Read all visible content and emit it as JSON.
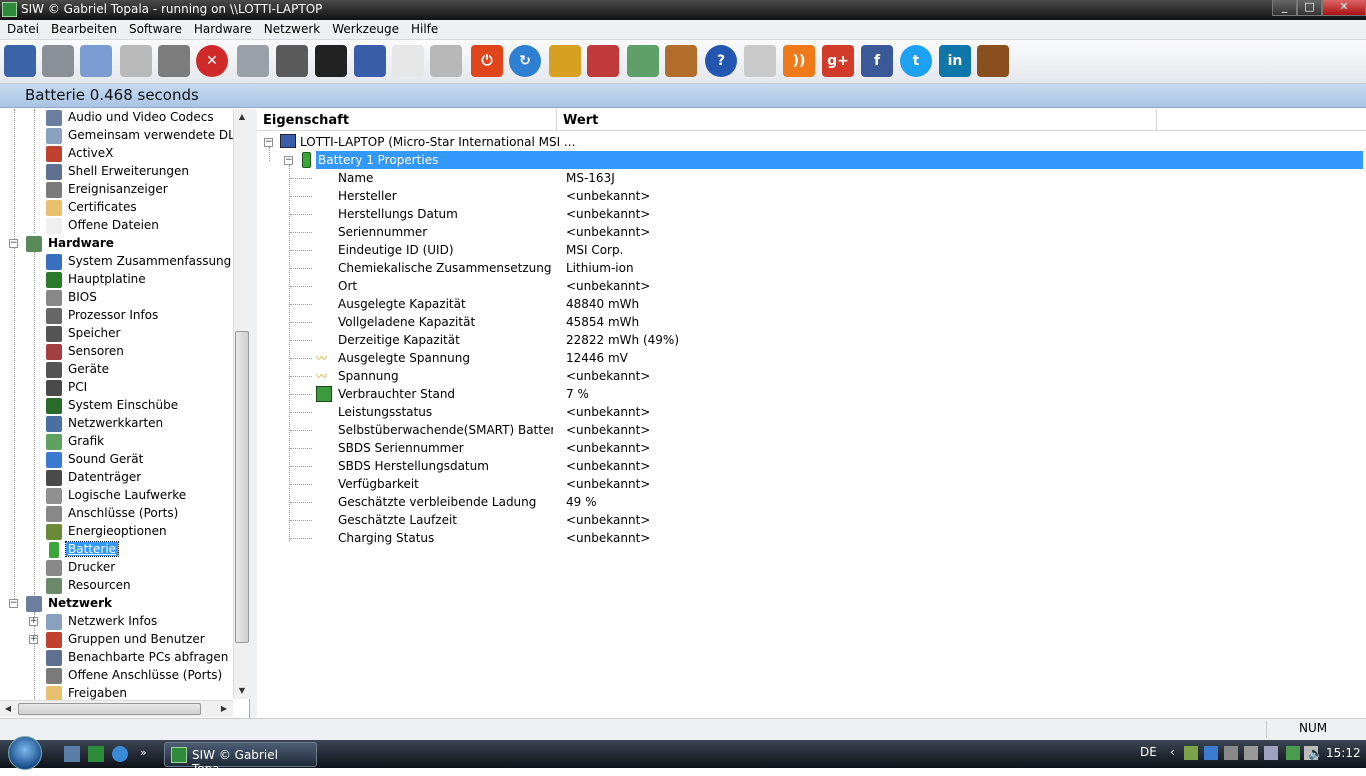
{
  "window": {
    "title": "SIW  © Gabriel Topala - running on \\\\LOTTI-LAPTOP"
  },
  "menu": [
    "Datei",
    "Bearbeiten",
    "Software",
    "Hardware",
    "Netzwerk",
    "Werkzeuge",
    "Hilfe"
  ],
  "toolbar": [
    "save",
    "cut",
    "copy",
    "paste",
    "print",
    "stop",
    "search",
    "gauge",
    "monitor",
    "network",
    "list",
    "stopwatch",
    "shutdown",
    "refresh",
    "key",
    "tools",
    "map",
    "home",
    "help",
    "mail",
    "rss",
    "google-plus",
    "facebook",
    "twitter",
    "linkedin",
    "coffee"
  ],
  "header": {
    "text": "Batterie 0.468 seconds"
  },
  "tree": {
    "items_top": [
      "Audio und Video Codecs",
      "Gemeinsam verwendete DLLs",
      "ActiveX",
      "Shell Erweiterungen",
      "Ereignisanzeiger",
      "Certificates",
      "Offene Dateien"
    ],
    "hardware_label": "Hardware",
    "hardware_items": [
      "System Zusammenfassung",
      "Hauptplatine",
      "BIOS",
      "Prozessor Infos",
      "Speicher",
      "Sensoren",
      "Geräte",
      "PCI",
      "System Einschübe",
      "Netzwerkkarten",
      "Grafik",
      "Sound Gerät",
      "Datenträger",
      "Logische Laufwerke",
      "Anschlüsse (Ports)",
      "Energieoptionen",
      "Batterie",
      "Drucker",
      "Resourcen"
    ],
    "network_label": "Netzwerk",
    "network_items": [
      "Netzwerk Infos",
      "Gruppen und Benutzer",
      "Benachbarte PCs abfragen",
      "Offene Anschlüsse (Ports)",
      "Freigaben"
    ],
    "selected": "Batterie"
  },
  "table": {
    "col_property": "Eigenschaft",
    "col_value": "Wert",
    "root": "LOTTI-LAPTOP (Micro-Star International MSI ...",
    "group": "Battery 1 Properties",
    "rows": [
      {
        "p": "Name",
        "v": "MS-163J"
      },
      {
        "p": "Hersteller",
        "v": "<unbekannt>"
      },
      {
        "p": "Herstellungs Datum",
        "v": "<unbekannt>"
      },
      {
        "p": "Seriennummer",
        "v": "<unbekannt>"
      },
      {
        "p": "Eindeutige ID (UID)",
        "v": "MSI Corp."
      },
      {
        "p": "Chemiekalische Zusammensetzung",
        "v": "Lithium-ion"
      },
      {
        "p": "Ort",
        "v": "<unbekannt>"
      },
      {
        "p": "Ausgelegte Kapazität",
        "v": "48840 mWh"
      },
      {
        "p": "Vollgeladene Kapazität",
        "v": "45854 mWh"
      },
      {
        "p": "Derzeitige Kapazität",
        "v": "22822 mWh (49%)"
      },
      {
        "p": "Ausgelegte Spannung",
        "v": "12446 mV"
      },
      {
        "p": "Spannung",
        "v": "<unbekannt>"
      },
      {
        "p": "Verbrauchter Stand",
        "v": "7 %"
      },
      {
        "p": "Leistungsstatus",
        "v": "<unbekannt>"
      },
      {
        "p": "Selbstüberwachende(SMART) Batterie ...",
        "v": "<unbekannt>"
      },
      {
        "p": "SBDS Seriennummer",
        "v": "<unbekannt>"
      },
      {
        "p": "SBDS Herstellungsdatum",
        "v": "<unbekannt>"
      },
      {
        "p": "Verfügbarkeit",
        "v": "<unbekannt>"
      },
      {
        "p": "Geschätzte verbleibende Ladung",
        "v": "49 %"
      },
      {
        "p": "Geschätzte Laufzeit",
        "v": "<unbekannt>"
      },
      {
        "p": "Charging Status",
        "v": "<unbekannt>"
      }
    ]
  },
  "status": {
    "num": "NUM"
  },
  "taskbar": {
    "button": "SIW  © Gabriel Topa...",
    "lang": "DE",
    "time": "15:12"
  }
}
